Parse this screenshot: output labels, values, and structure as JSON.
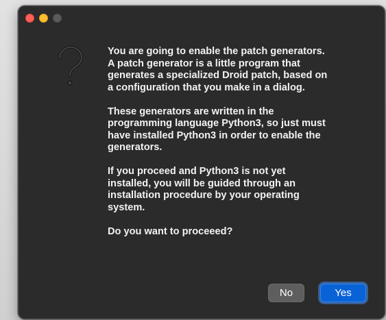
{
  "window": {
    "controls": {
      "close_color": "#ff5f57",
      "minimize_color": "#febc2e",
      "zoom_color": "#5a5a5a"
    },
    "icon": "question-mark-icon"
  },
  "dialog": {
    "paragraphs": [
      "You are going to enable the patch generators.\nA patch generator is a little program that\ngenerates a specialized Droid patch, based on\na configuration that you make in a dialog.",
      "These generators are written in the\nprogramming language Python3, so just must\nhave installed Python3 in order to enable the\ngenerators.",
      "If you proceed and Python3 is not yet\ninstalled, you will be guided through an\ninstallation procedure by your operating\nsystem.",
      "Do you want to proceeed?"
    ],
    "buttons": {
      "no_label": "No",
      "yes_label": "Yes"
    },
    "accent_color": "#0a63d6"
  }
}
